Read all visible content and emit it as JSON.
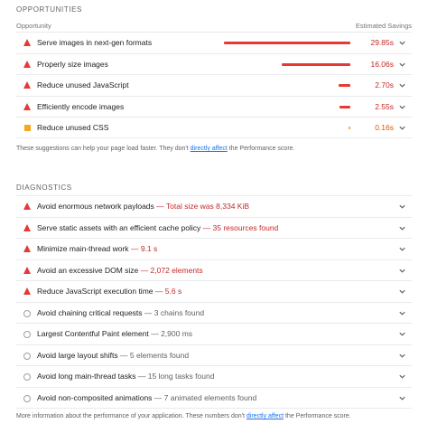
{
  "opportunities": {
    "title": "OPPORTUNITIES",
    "col_left": "Opportunity",
    "col_right": "Estimated Savings",
    "items": [
      {
        "label": "Serve images in next-gen formats",
        "saving": "29.85s",
        "fraction": 1.0,
        "level": "fail"
      },
      {
        "label": "Properly size images",
        "saving": "16.06s",
        "fraction": 0.54,
        "level": "fail"
      },
      {
        "label": "Reduce unused JavaScript",
        "saving": "2.70s",
        "fraction": 0.09,
        "level": "fail"
      },
      {
        "label": "Efficiently encode images",
        "saving": "2.55s",
        "fraction": 0.085,
        "level": "fail"
      },
      {
        "label": "Reduce unused CSS",
        "saving": "0.16s",
        "fraction": 0.005,
        "level": "average"
      }
    ],
    "note_before": "These suggestions can help your page load faster. They don't ",
    "note_link": "directly affect",
    "note_after": " the Performance score."
  },
  "diagnostics": {
    "title": "DIAGNOSTICS",
    "items": [
      {
        "label": "Avoid enormous network payloads",
        "sep": "—",
        "display": "Total size was 8,334 KiB",
        "level": "fail"
      },
      {
        "label": "Serve static assets with an efficient cache policy",
        "sep": "—",
        "display": "35 resources found",
        "level": "fail"
      },
      {
        "label": "Minimize main-thread work",
        "sep": "—",
        "display": "9.1 s",
        "level": "fail"
      },
      {
        "label": "Avoid an excessive DOM size",
        "sep": "—",
        "display": "2,072 elements",
        "level": "fail"
      },
      {
        "label": "Reduce JavaScript execution time",
        "sep": "—",
        "display": "5.6 s",
        "level": "fail"
      },
      {
        "label": "Avoid chaining critical requests",
        "sep": "—",
        "display": "3 chains found",
        "level": "info"
      },
      {
        "label": "Largest Contentful Paint element",
        "sep": "—",
        "display": "2,900 ms",
        "level": "info"
      },
      {
        "label": "Avoid large layout shifts",
        "sep": "—",
        "display": "5 elements found",
        "level": "info"
      },
      {
        "label": "Avoid long main-thread tasks",
        "sep": "—",
        "display": "15 long tasks found",
        "level": "info"
      },
      {
        "label": "Avoid non-composited animations",
        "sep": "—",
        "display": "7 animated elements found",
        "level": "info"
      }
    ],
    "note_before": "More information about the performance of your application. These numbers don't ",
    "note_link": "directly affect",
    "note_after": " the Performance score."
  },
  "icons": {
    "fail": "warning-triangle-icon",
    "average": "average-square-icon",
    "info": "info-circle-icon",
    "expand": "chevron-down-icon"
  },
  "colors": {
    "fail": "#e53935",
    "average": "#f5a623",
    "link": "#1a73e8"
  }
}
